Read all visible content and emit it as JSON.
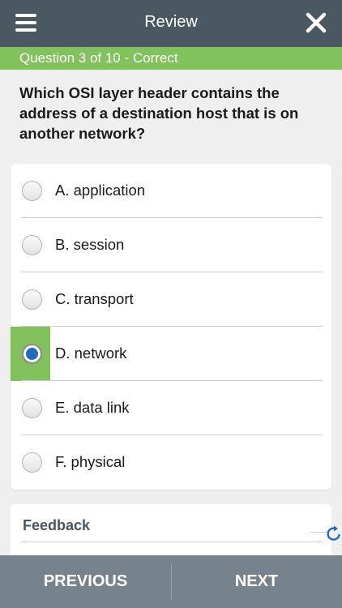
{
  "header": {
    "title": "Review"
  },
  "status": {
    "text": "Question 3 of 10 - Correct"
  },
  "question": {
    "text": "Which OSI layer header contains the address of a destination host that is on another network?"
  },
  "options": [
    {
      "label": "A. application",
      "selected": false
    },
    {
      "label": "B. session",
      "selected": false
    },
    {
      "label": "C. transport",
      "selected": false
    },
    {
      "label": "D. network",
      "selected": true
    },
    {
      "label": "E. data link",
      "selected": false
    },
    {
      "label": "F. physical",
      "selected": false
    }
  ],
  "feedback": {
    "title": "Feedback"
  },
  "footer": {
    "previous_label": "PREVIOUS",
    "next_label": "NEXT"
  },
  "colors": {
    "header": "#4a5861",
    "correct": "#82c25d",
    "footer": "#76838c",
    "radio_selected": "#1f6cc4",
    "refresh": "#1f6cc4"
  },
  "icons": {
    "menu": "hamburger-menu-icon",
    "close": "close-icon",
    "refresh": "refresh-icon"
  }
}
